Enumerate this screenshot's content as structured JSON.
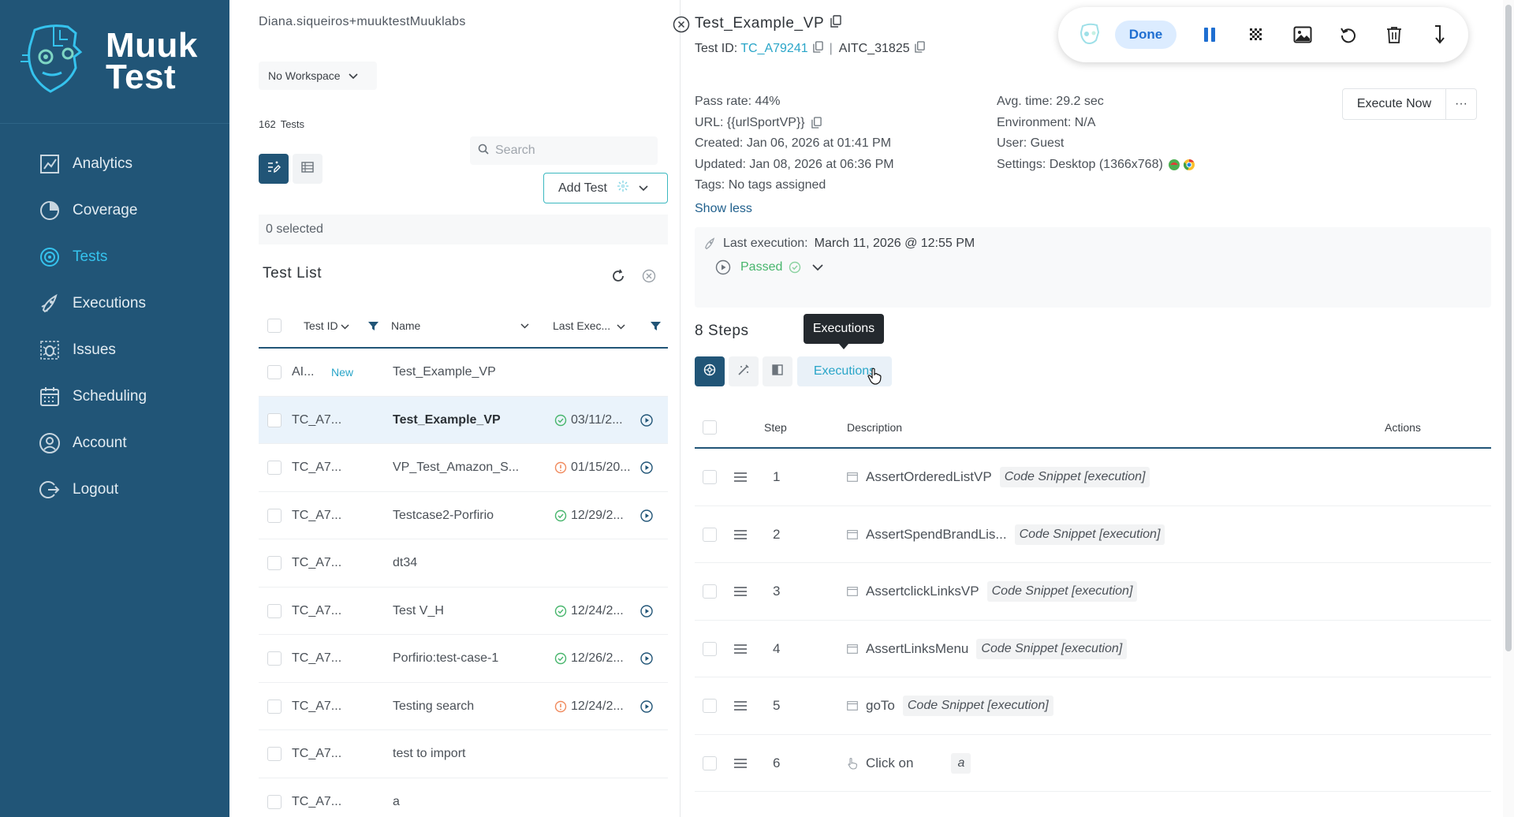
{
  "brand": {
    "line1": "Muuk",
    "line2": "Test"
  },
  "sidebar": {
    "items": [
      {
        "label": "Analytics",
        "icon": "analytics-icon"
      },
      {
        "label": "Coverage",
        "icon": "coverage-icon"
      },
      {
        "label": "Tests",
        "icon": "tests-icon"
      },
      {
        "label": "Executions",
        "icon": "rocket-icon"
      },
      {
        "label": "Issues",
        "icon": "bug-icon"
      },
      {
        "label": "Scheduling",
        "icon": "calendar-icon"
      },
      {
        "label": "Account",
        "icon": "user-icon"
      },
      {
        "label": "Logout",
        "icon": "logout-icon"
      }
    ],
    "active_color": "#35c3ee",
    "bg_color": "#215577"
  },
  "listpanel": {
    "user": "Diana.siqueiros+muuktestMuuklabs",
    "workspace": "No Workspace",
    "count": "162",
    "count_label": "Tests",
    "search_placeholder": "Search",
    "add_test": "Add Test",
    "selected": "0 selected",
    "title": "Test List",
    "columns": {
      "id": "Test ID",
      "name": "Name",
      "last": "Last Exec..."
    },
    "rows": [
      {
        "id": "AI...",
        "badge": "New",
        "name": "Test_Example_VP",
        "status": "",
        "date": "",
        "play": false,
        "active": false
      },
      {
        "id": "TC_A7...",
        "badge": "",
        "name": "Test_Example_VP",
        "status": "passed",
        "date": "03/11/2...",
        "play": true,
        "active": true
      },
      {
        "id": "TC_A7...",
        "badge": "",
        "name": "VP_Test_Amazon_S...",
        "status": "failed",
        "date": "01/15/20...",
        "play": true,
        "active": false
      },
      {
        "id": "TC_A7...",
        "badge": "",
        "name": "Testcase2-Porfirio",
        "status": "passed",
        "date": "12/29/2...",
        "play": true,
        "active": false
      },
      {
        "id": "TC_A7...",
        "badge": "",
        "name": "dt34",
        "status": "",
        "date": "",
        "play": false,
        "active": false
      },
      {
        "id": "TC_A7...",
        "badge": "",
        "name": "Test V_H",
        "status": "passed",
        "date": "12/24/2...",
        "play": true,
        "active": false
      },
      {
        "id": "TC_A7...",
        "badge": "",
        "name": "Porfirio:test-case-1",
        "status": "passed",
        "date": "12/26/2...",
        "play": true,
        "active": false
      },
      {
        "id": "TC_A7...",
        "badge": "",
        "name": "Testing search",
        "status": "failed",
        "date": "12/24/2...",
        "play": true,
        "active": false
      },
      {
        "id": "TC_A7...",
        "badge": "",
        "name": "test to import",
        "status": "",
        "date": "",
        "play": false,
        "active": false
      },
      {
        "id": "TC_A7...",
        "badge": "",
        "name": "a",
        "status": "",
        "date": "",
        "play": false,
        "active": false
      }
    ]
  },
  "detail": {
    "title": "Test_Example_VP",
    "test_id_label": "Test ID:",
    "test_id": "TC_A79241",
    "aitc": "AITC_31825",
    "meta_left": [
      "Pass rate: 44%",
      "URL: {{urlSportVP}}",
      "Created: Jan 06, 2026 at 01:41 PM",
      "Updated: Jan 08, 2026 at 06:36 PM",
      "Tags: No tags assigned"
    ],
    "meta_right": [
      "Avg. time: 29.2 sec",
      "Environment: N/A",
      "User: Guest",
      "Settings: Desktop (1366x768)"
    ],
    "show_less": "Show less",
    "execute_now": "Execute Now",
    "more": "···",
    "last_exec_label": "Last execution:",
    "last_exec_value": "March 11, 2026 @ 12:55 PM",
    "last_exec_status": "Passed",
    "steps_title": "8 Steps",
    "tooltip": "Executions",
    "executions_btn": "Executions",
    "step_columns": {
      "step": "Step",
      "description": "Description",
      "actions": "Actions"
    },
    "steps": [
      {
        "num": "1",
        "desc": "AssertOrderedListVP",
        "tag": "Code Snippet [execution]",
        "icon": "code-icon"
      },
      {
        "num": "2",
        "desc": "AssertSpendBrandLis...",
        "tag": "Code Snippet [execution]",
        "icon": "code-icon"
      },
      {
        "num": "3",
        "desc": "AssertclickLinksVP",
        "tag": "Code Snippet [execution]",
        "icon": "code-icon"
      },
      {
        "num": "4",
        "desc": "AssertLinksMenu",
        "tag": "Code Snippet [execution]",
        "icon": "code-icon"
      },
      {
        "num": "5",
        "desc": "goTo",
        "tag": "Code Snippet [execution]",
        "icon": "code-icon"
      },
      {
        "num": "6",
        "desc": "Click on",
        "tag": "a",
        "icon": "click-icon"
      }
    ]
  },
  "toolbar": {
    "done": "Done"
  },
  "colors": {
    "accent": "#29a5c8",
    "passed": "#47b56c",
    "failed": "#f08a5d",
    "navy": "#215577"
  }
}
